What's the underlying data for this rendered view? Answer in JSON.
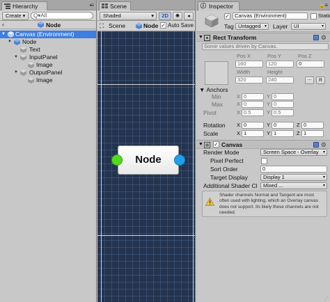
{
  "hierarchy": {
    "tab_label": "Hierarchy",
    "create_label": "Create",
    "search_icon": "search-icon",
    "search_glyph": "Q▾All",
    "breadcrumb": {
      "back_glyph": "‹",
      "label": "Node"
    },
    "items": [
      {
        "label": "Canvas (Environment)",
        "arrow": "▼",
        "selected": true
      },
      {
        "label": "Node",
        "arrow": "▼"
      },
      {
        "label": "Text"
      },
      {
        "label": "InputPanel",
        "arrow": "▼"
      },
      {
        "label": "Image"
      },
      {
        "label": "OutputPanel",
        "arrow": "▼"
      },
      {
        "label": "Image"
      }
    ]
  },
  "scene": {
    "tab_label": "Scene",
    "shading_mode": "Shaded",
    "mode_2d": "2D",
    "light_icon": "light-icon",
    "breadcrumb": {
      "scene_label": "Scene",
      "node_label": "Node"
    },
    "auto_save_label": "Auto Save",
    "auto_save_checked": "✓",
    "node": {
      "label": "Node"
    },
    "colors": {
      "background": "#24344f",
      "input_port": "#52d91c",
      "output_port": "#1ea0ea"
    }
  },
  "inspector": {
    "tab_label": "Inspector",
    "lock_icon": "lock-icon",
    "object_name": "Canvas (Environment)",
    "active_checked": "✓",
    "static_label": "Static",
    "tag_label": "Tag",
    "tag_value": "Untagged",
    "layer_label": "Layer",
    "layer_value": "UI",
    "rect_transform": {
      "title": "Rect Transform",
      "note": "Some values driven by Canvas.",
      "headers": {
        "pos_x": "Pos X",
        "pos_y": "Pos Y",
        "pos_z": "Pos Z",
        "width": "Width",
        "height": "Height"
      },
      "pos_x": "160",
      "pos_y": "120",
      "pos_z": "0",
      "width": "320",
      "height": "240",
      "blueprint_btn": "⋯",
      "r_btn": "R",
      "anchors_label": "Anchors",
      "min_label": "Min",
      "min_x": "0",
      "min_y": "0",
      "max_label": "Max",
      "max_x": "0",
      "max_y": "0",
      "pivot_label": "Pivot",
      "pivot_x": "0.5",
      "pivot_y": "0.5",
      "rotation_label": "Rotation",
      "rot_x": "0",
      "rot_y": "0",
      "rot_z": "0",
      "scale_label": "Scale",
      "scale_x": "1",
      "scale_y": "1",
      "scale_z": "1",
      "axis_x": "X",
      "axis_y": "Y",
      "axis_z": "Z"
    },
    "canvas": {
      "title": "Canvas",
      "enabled_checked": "✓",
      "render_mode_label": "Render Mode",
      "render_mode_value": "Screen Space - Overlay",
      "pixel_perfect_label": "Pixel Perfect",
      "sort_order_label": "Sort Order",
      "sort_order_value": "0",
      "target_display_label": "Target Display",
      "target_display_value": "Display 1",
      "additional_shader_label": "Additional Shader Cl",
      "additional_shader_value": "Mixed ...",
      "help_text": "Shader channels Normal and Tangent are most often used with lighting, which an Overlay canvas does not support. Its likely these channels are not needed."
    }
  }
}
